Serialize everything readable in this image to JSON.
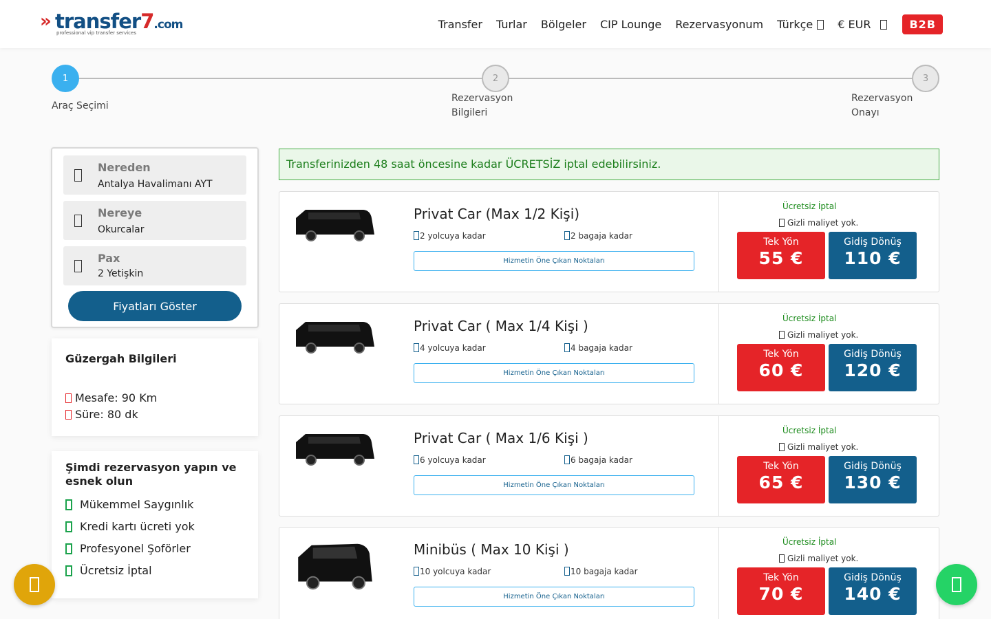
{
  "logo": {
    "brand": "transfer",
    "brand_num": "7",
    "brand_tld": ".com",
    "tagline": "professional vip transfer services"
  },
  "nav": {
    "items": [
      "Transfer",
      "Turlar",
      "Bölgeler",
      "CIP Lounge",
      "Rezervasyonum"
    ],
    "language": "Türkçe",
    "currency": "€ EUR",
    "b2b": "B2B"
  },
  "stepper": {
    "steps": [
      {
        "number": "1",
        "label": "Araç Seçimi",
        "active": true
      },
      {
        "number": "2",
        "label_line1": "Rezervasyon",
        "label_line2": "Bilgileri",
        "active": false
      },
      {
        "number": "3",
        "label_line1": "Rezervasyon",
        "label_line2": "Onayı",
        "active": false
      }
    ]
  },
  "search": {
    "from_label": "Nereden",
    "from_value": "Antalya Havalimanı AYT",
    "to_label": "Nereye",
    "to_value": "Okurcalar",
    "pax_label": "Pax",
    "pax_value": "2 Yetişkin",
    "button": "Fiyatları Göster"
  },
  "route": {
    "title": "Güzergah Bilgileri",
    "distance": "Mesafe: 90 Km",
    "duration": "Süre: 80 dk"
  },
  "benefits": {
    "title": "Şimdi rezervasyon yapın ve esnek olun",
    "items": [
      "Mükemmel Saygınlık",
      "Kredi kartı ücreti yok",
      "Profesyonel Şoförler",
      "Ücretsiz İptal"
    ]
  },
  "notice": "Transferinizden 48 saat öncesine kadar ÜCRETSİZ iptal edebilirsiniz.",
  "vehicles": [
    {
      "name": "Privat Car (Max 1/2 Kişi)",
      "passengers": "2 yolcuya kadar",
      "luggage": "2 bagaja kadar",
      "features_btn": "Hizmetin Öne Çıkan Noktaları",
      "cancel": "Ücretsiz İptal",
      "hidden_cost": "Gizli maliyet yok.",
      "one_way_label": "Tek Yön",
      "one_way_price": "55 €",
      "round_label": "Gidiş Dönüş",
      "round_price": "110 €"
    },
    {
      "name": "Privat Car ( Max 1/4 Kişi )",
      "passengers": "4 yolcuya kadar",
      "luggage": "4 bagaja kadar",
      "features_btn": "Hizmetin Öne Çıkan Noktaları",
      "cancel": "Ücretsiz İptal",
      "hidden_cost": "Gizli maliyet yok.",
      "one_way_label": "Tek Yön",
      "one_way_price": "60 €",
      "round_label": "Gidiş Dönüş",
      "round_price": "120 €"
    },
    {
      "name": "Privat Car ( Max 1/6 Kişi )",
      "passengers": "6 yolcuya kadar",
      "luggage": "6 bagaja kadar",
      "features_btn": "Hizmetin Öne Çıkan Noktaları",
      "cancel": "Ücretsiz İptal",
      "hidden_cost": "Gizli maliyet yok.",
      "one_way_label": "Tek Yön",
      "one_way_price": "65 €",
      "round_label": "Gidiş Dönüş",
      "round_price": "130 €"
    },
    {
      "name": "Minibüs ( Max 10 Kişi )",
      "passengers": "10 yolcuya kadar",
      "luggage": "10 bagaja kadar",
      "features_btn": "Hizmetin Öne Çıkan Noktaları",
      "cancel": "Ücretsiz İptal",
      "hidden_cost": "Gizli maliyet yok.",
      "one_way_label": "Tek Yön",
      "one_way_price": "70 €",
      "round_label": "Gidiş Dönüş",
      "round_price": "140 €"
    }
  ],
  "colors": {
    "brand_blue": "#135f8c",
    "brand_red": "#e52428",
    "step_active": "#3ab0ef",
    "success_green": "#1a8a1a",
    "whatsapp_green": "#25d366",
    "call_yellow": "#e0a50a"
  },
  "icons": {
    "nav_language": "chevron-down-icon",
    "nav_currency": "chevron-down-icon",
    "from": "map-marker-icon",
    "to": "map-marker-icon",
    "pax": "user-icon",
    "distance": "route-icon",
    "duration": "clock-icon",
    "benefit": "check-icon",
    "passengers": "user-icon",
    "luggage": "suitcase-icon",
    "hidden_cost": "check-icon",
    "fab_left": "phone-icon",
    "fab_right": "whatsapp-icon"
  }
}
